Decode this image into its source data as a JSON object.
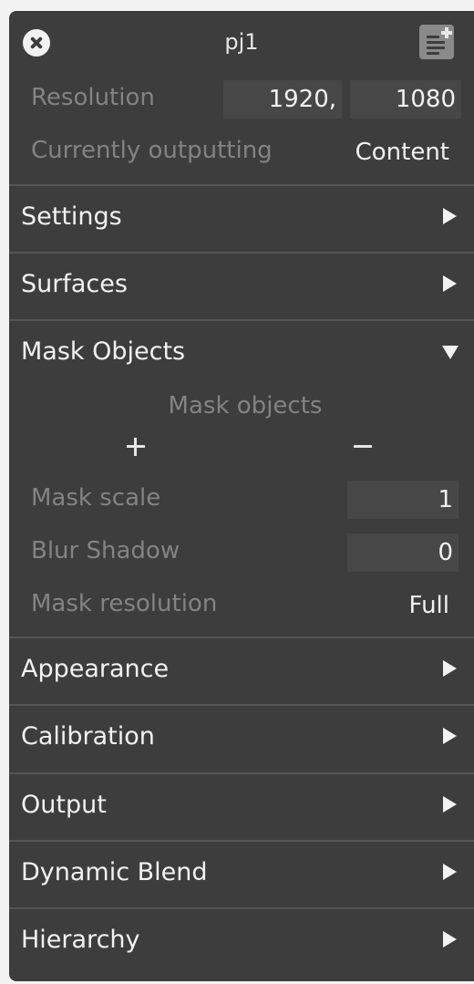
{
  "header": {
    "title": "pj1",
    "close_icon": "close-circle-icon",
    "note_icon": "note-add-icon"
  },
  "info": {
    "resolution_label": "Resolution",
    "resolution_width": "1920,",
    "resolution_height": "1080",
    "outputting_label": "Currently outputting",
    "outputting_value": "Content"
  },
  "sections": {
    "settings": "Settings",
    "surfaces": "Surfaces",
    "mask_objects": "Mask Objects",
    "appearance": "Appearance",
    "calibration": "Calibration",
    "output": "Output",
    "dynamic_blend": "Dynamic Blend",
    "hierarchy": "Hierarchy"
  },
  "mask": {
    "heading": "Mask objects",
    "scale_label": "Mask scale",
    "scale_value": "1",
    "blur_label": "Blur Shadow",
    "blur_value": "0",
    "resolution_label": "Mask resolution",
    "resolution_value": "Full"
  },
  "colors": {
    "panel_bg": "#3d3d3d",
    "page_bg": "#f2f2f2",
    "field_bg": "#474747",
    "muted_text": "#838383",
    "text": "#f2f2f2"
  }
}
